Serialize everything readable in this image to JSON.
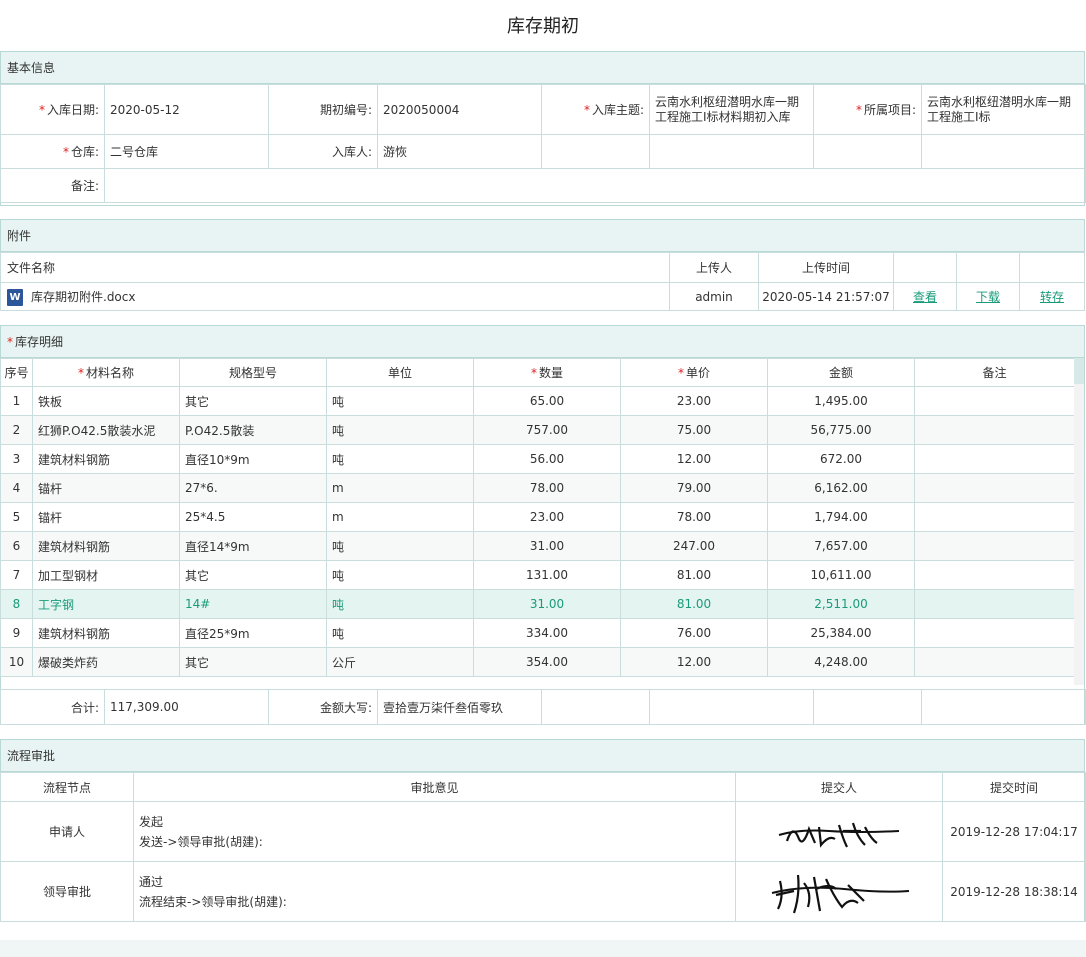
{
  "title": "库存期初",
  "basic": {
    "header": "基本信息",
    "fields": {
      "date_label": "入库日期:",
      "date_value": "2020-05-12",
      "code_label": "期初编号:",
      "code_value": "2020050004",
      "subject_label": "入库主题:",
      "subject_value": "云南水利枢纽潜明水库一期工程施工I标材料期初入库",
      "project_label": "所属项目:",
      "project_value": "云南水利枢纽潜明水库一期工程施工I标",
      "warehouse_label": "仓库:",
      "warehouse_value": "二号仓库",
      "person_label": "入库人:",
      "person_value": "游恢",
      "remark_label": "备注:",
      "remark_value": ""
    }
  },
  "attachments": {
    "header": "附件",
    "columns": [
      "文件名称",
      "上传人",
      "上传时间"
    ],
    "files": [
      {
        "icon": "word-doc-icon",
        "name": "库存期初附件.docx",
        "uploader": "admin",
        "time": "2020-05-14 21:57:07",
        "view": "查看",
        "download": "下载",
        "forward": "转存"
      }
    ]
  },
  "detail": {
    "header": "库存明细",
    "columns": {
      "no": "序号",
      "name": "材料名称",
      "spec": "规格型号",
      "unit": "单位",
      "qty": "数量",
      "price": "单价",
      "amount": "金额",
      "remark": "备注"
    },
    "rows": [
      {
        "no": "1",
        "name": "铁板",
        "spec": "其它",
        "unit": "吨",
        "qty": "65.00",
        "price": "23.00",
        "amount": "1,495.00",
        "remark": ""
      },
      {
        "no": "2",
        "name": "红狮P.O42.5散装水泥",
        "spec": "P.O42.5散装",
        "unit": "吨",
        "qty": "757.00",
        "price": "75.00",
        "amount": "56,775.00",
        "remark": ""
      },
      {
        "no": "3",
        "name": "建筑材料钢筋",
        "spec": "直径10*9m",
        "unit": "吨",
        "qty": "56.00",
        "price": "12.00",
        "amount": "672.00",
        "remark": ""
      },
      {
        "no": "4",
        "name": "锚杆",
        "spec": "27*6.",
        "unit": "m",
        "qty": "78.00",
        "price": "79.00",
        "amount": "6,162.00",
        "remark": ""
      },
      {
        "no": "5",
        "name": "锚杆",
        "spec": "25*4.5",
        "unit": "m",
        "qty": "23.00",
        "price": "78.00",
        "amount": "1,794.00",
        "remark": ""
      },
      {
        "no": "6",
        "name": "建筑材料钢筋",
        "spec": "直径14*9m",
        "unit": "吨",
        "qty": "31.00",
        "price": "247.00",
        "amount": "7,657.00",
        "remark": ""
      },
      {
        "no": "7",
        "name": "加工型钢材",
        "spec": "其它",
        "unit": "吨",
        "qty": "131.00",
        "price": "81.00",
        "amount": "10,611.00",
        "remark": ""
      },
      {
        "no": "8",
        "name": "工字钢",
        "spec": "14#",
        "unit": "吨",
        "qty": "31.00",
        "price": "81.00",
        "amount": "2,511.00",
        "remark": ""
      },
      {
        "no": "9",
        "name": "建筑材料钢筋",
        "spec": "直径25*9m",
        "unit": "吨",
        "qty": "334.00",
        "price": "76.00",
        "amount": "25,384.00",
        "remark": ""
      },
      {
        "no": "10",
        "name": "爆破类炸药",
        "spec": "其它",
        "unit": "公斤",
        "qty": "354.00",
        "price": "12.00",
        "amount": "4,248.00",
        "remark": ""
      }
    ],
    "total_label": "合计:",
    "total_value": "117,309.00",
    "upper_label": "金额大写:",
    "upper_value": "壹拾壹万柒仟叁佰零玖"
  },
  "approval": {
    "header": "流程审批",
    "columns": [
      "流程节点",
      "审批意见",
      "提交人",
      "提交时间"
    ],
    "rows": [
      {
        "node": "申请人",
        "opinion": "发起",
        "detail": "发送->领导审批(胡建):",
        "time": "2019-12-28 17:04:17"
      },
      {
        "node": "领导审批",
        "opinion": "通过",
        "detail": "流程结束->领导审批(胡建):",
        "time": "2019-12-28 18:38:14"
      }
    ]
  },
  "colors": {
    "accent": "#1a9a7a",
    "header_bg": "#e8f4f3",
    "border": "#b9d9d7",
    "required": "#e02020"
  }
}
